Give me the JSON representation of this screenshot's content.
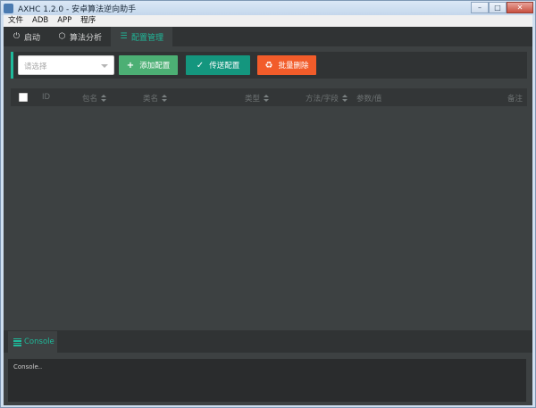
{
  "window": {
    "title": "AXHC 1.2.0 - 安卓算法逆向助手",
    "controls": {
      "minimize": "–",
      "maximize": "□",
      "close": "✕"
    }
  },
  "menu": [
    "文件",
    "ADB",
    "APP",
    "程序"
  ],
  "tabs": [
    {
      "label": "启动",
      "icon": "power-icon",
      "glyph": "⏻"
    },
    {
      "label": "算法分析",
      "icon": "cube-icon",
      "glyph": "⬡"
    },
    {
      "label": "配置管理",
      "icon": "list-icon",
      "glyph": "☰"
    }
  ],
  "toolbar": {
    "select_placeholder": "请选择",
    "add_label": "添加配置",
    "send_label": "传送配置",
    "delete_label": "批量删除"
  },
  "table": {
    "columns": [
      "ID",
      "包名",
      "类名",
      "类型",
      "方法/字段",
      "参数/值",
      "备注"
    ]
  },
  "console": {
    "tab_label": "Console",
    "text": "Console.."
  },
  "colors": {
    "accent": "#1fb99a",
    "add_button": "#4caf74",
    "send_button": "#14967e",
    "delete_button": "#f25c2a",
    "background": "#3d4142"
  }
}
